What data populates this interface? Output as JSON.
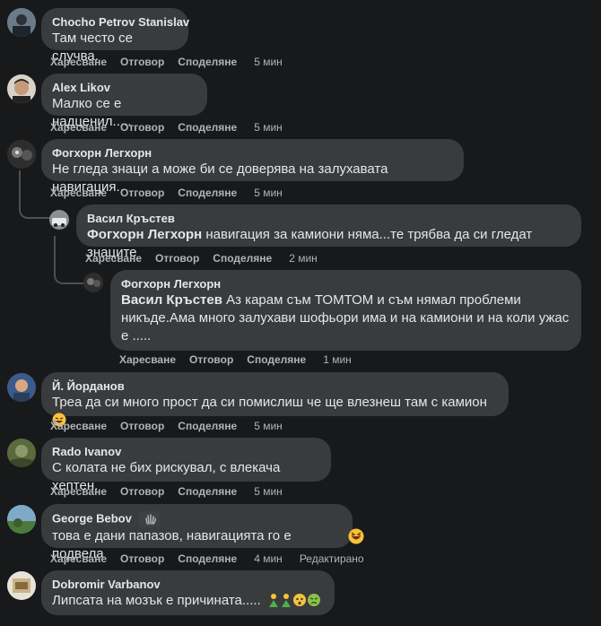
{
  "comments": [
    {
      "name": "Chocho Petrov Stanislav",
      "text": "Там често се случва.",
      "time": "5 мин"
    },
    {
      "name": "Alex Likov",
      "text": "Малко се е надценил.....",
      "time": "5 мин"
    },
    {
      "name": "Фогхорн Легхорн",
      "text": "Не гледа знаци а може би се доверява на залухавата навигация..",
      "time": "5 мин",
      "replies": [
        {
          "name": "Васил Кръстев",
          "mention": "Фогхорн Легхорн",
          "text": "навигация за камиони няма...те трябва да си гледат знаците",
          "time": "2 мин"
        },
        {
          "name": "Фогхорн Легхорн",
          "mention": "Васил Кръстев",
          "text": "Аз карам съм ТОМТОМ и съм нямал проблеми",
          "text2": "никъде.Ама много залухави шофьори има и на камиони и на коли ужас",
          "text3": "е .....",
          "time": "1 мин"
        }
      ]
    },
    {
      "name": "Й. Йорданов",
      "text": "Треа да си много прост да си помислиш че ще влезнеш там с камион",
      "time": "5 мин"
    },
    {
      "name": "Rado Ivanov",
      "text": "С колата не бих рискувал, с влекача хептен.",
      "time": "5 мин"
    },
    {
      "name": "George Bebov",
      "text": "това е дани папазов, навигацията го е подвела",
      "time": "4 мин",
      "edited": "Редактирано"
    },
    {
      "name": "Dobromir Varbanov",
      "text": "Липсата на мозък е причината....."
    }
  ],
  "actions": {
    "like": "Харесване",
    "reply": "Отговор",
    "share": "Споделяне"
  },
  "icons": {
    "badge": "waving-hand-icon",
    "emoji_laugh": "rolling-laughing-emoji",
    "emoji_xd": "grinning-squinting-emoji"
  },
  "colors": {
    "bg": "#18191a",
    "bubble": "#3a3b3c",
    "meta": "#b0b3b8",
    "text": "#e4e6eb"
  }
}
